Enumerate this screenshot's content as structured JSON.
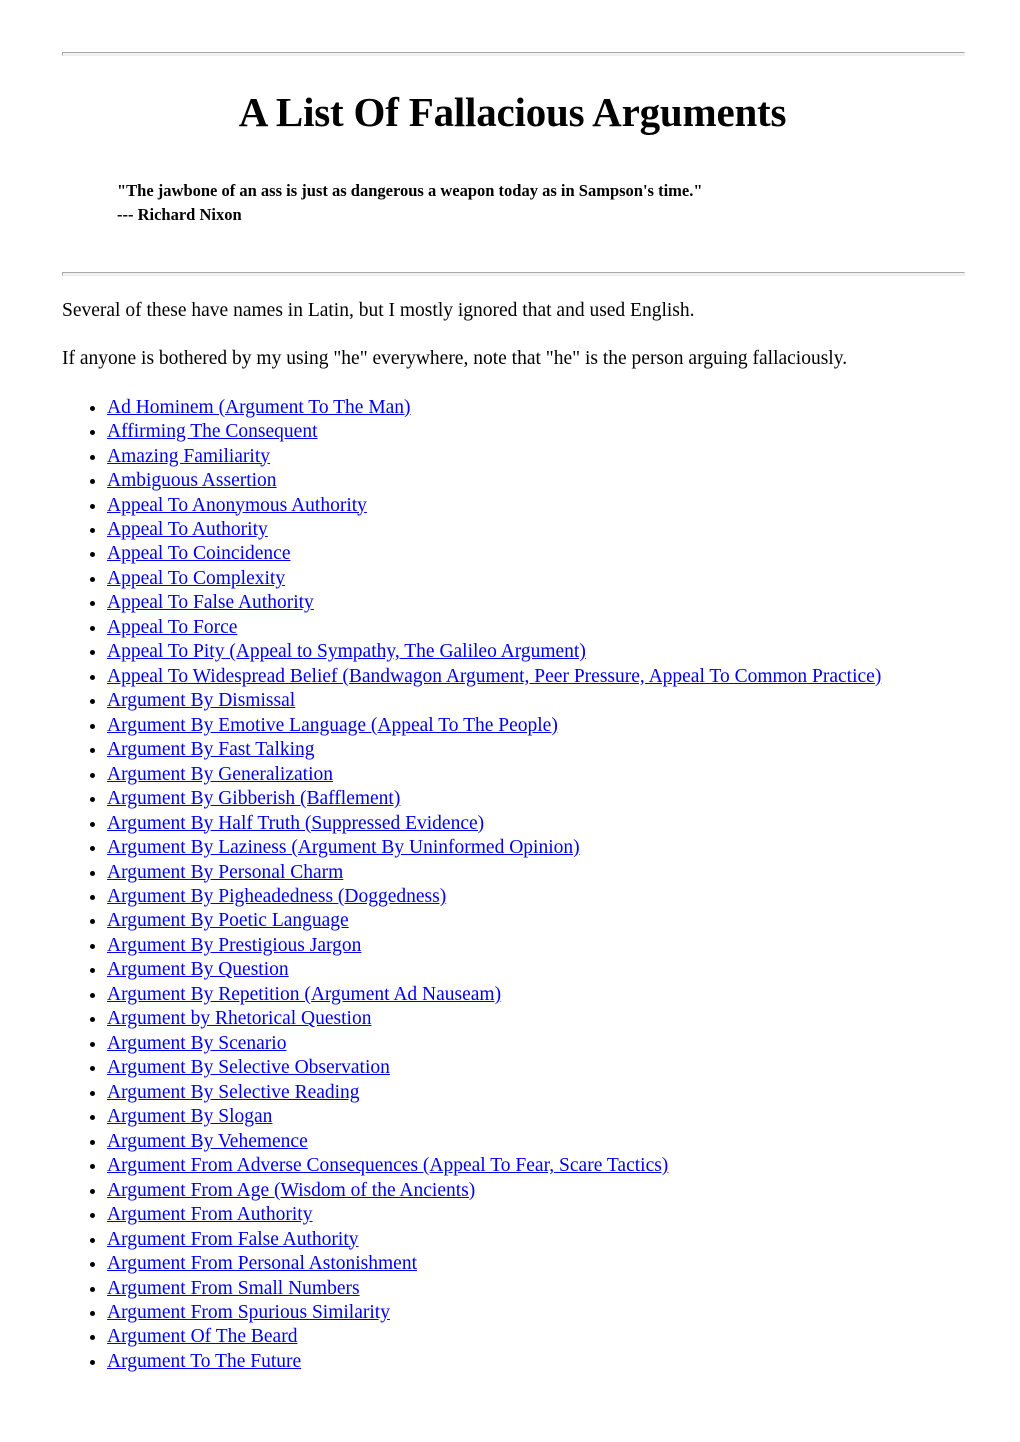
{
  "document": {
    "title": "A List Of Fallacious Arguments",
    "link_color": "#0000EE",
    "text_color": "#000000",
    "background_color": "#FFFFFF"
  },
  "epigraph": {
    "quote": "\"The jawbone of an ass is just as dangerous a weapon today as in Sampson's time.\"",
    "attribution": "--- Richard Nixon"
  },
  "intro": {
    "paragraph_1": "Several of these have names in Latin, but I mostly ignored that and used English.",
    "paragraph_2": "If anyone is bothered by my using \"he\" everywhere, note that \"he\" is the person arguing fallaciously."
  },
  "fallacy_list": [
    "Ad Hominem (Argument To The Man)",
    "Affirming The Consequent",
    "Amazing Familiarity",
    "Ambiguous Assertion",
    "Appeal To Anonymous Authority",
    "Appeal To Authority",
    "Appeal To Coincidence",
    "Appeal To Complexity",
    "Appeal To False Authority",
    "Appeal To Force",
    "Appeal To Pity (Appeal to Sympathy, The Galileo Argument)",
    "Appeal To Widespread Belief (Bandwagon Argument, Peer Pressure, Appeal To Common Practice)",
    "Argument By Dismissal",
    "Argument By Emotive Language (Appeal To The People)",
    "Argument By Fast Talking",
    "Argument By Generalization",
    "Argument By Gibberish (Bafflement)",
    "Argument By Half Truth (Suppressed Evidence)",
    "Argument By Laziness (Argument By Uninformed Opinion)",
    "Argument By Personal Charm",
    "Argument By Pigheadedness (Doggedness)",
    "Argument By Poetic Language",
    "Argument By Prestigious Jargon",
    "Argument By Question",
    "Argument By Repetition (Argument Ad Nauseam)",
    "Argument by Rhetorical Question",
    "Argument By Scenario",
    "Argument By Selective Observation",
    "Argument By Selective Reading",
    "Argument By Slogan",
    "Argument By Vehemence",
    "Argument From Adverse Consequences (Appeal To Fear, Scare Tactics)",
    "Argument From Age (Wisdom of the Ancients)",
    "Argument From Authority",
    "Argument From False Authority",
    "Argument From Personal Astonishment",
    "Argument From Small Numbers",
    "Argument From Spurious Similarity",
    "Argument Of The Beard",
    "Argument To The Future"
  ]
}
